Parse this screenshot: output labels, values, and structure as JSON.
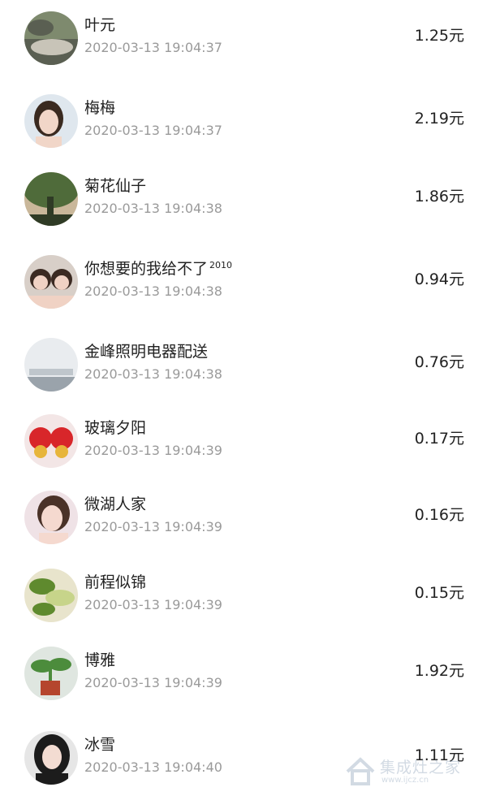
{
  "items": [
    {
      "name": "叶元",
      "name_sup": "",
      "time": "2020-03-13 19:04:37",
      "amount": "1.25元",
      "avatar_icon": "landscape-rock-photo",
      "colors": [
        "#7e8a6e",
        "#c8c4b8",
        "#5a5f52"
      ]
    },
    {
      "name": "梅梅",
      "name_sup": "",
      "time": "2020-03-13 19:04:37",
      "amount": "2.19元",
      "avatar_icon": "girl-portrait-photo",
      "colors": [
        "#dfe7ee",
        "#f1d6c8",
        "#3a2a20"
      ]
    },
    {
      "name": "菊花仙子",
      "name_sup": "",
      "time": "2020-03-13 19:04:38",
      "amount": "1.86元",
      "avatar_icon": "tree-garden-photo",
      "colors": [
        "#4f6b3a",
        "#c9b79a",
        "#2f3b25"
      ]
    },
    {
      "name": "你想要的我给不了",
      "name_sup": "2010",
      "time": "2020-03-13 19:04:38",
      "amount": "0.94元",
      "avatar_icon": "two-children-photo",
      "colors": [
        "#d8cfc8",
        "#f0d2c4",
        "#3b2a22"
      ]
    },
    {
      "name": "金峰照明电器配送",
      "name_sup": "",
      "time": "2020-03-13 19:04:38",
      "amount": "0.76元",
      "avatar_icon": "office-wall-photo",
      "colors": [
        "#e9ecef",
        "#bfc6cc",
        "#9aa3ab"
      ]
    },
    {
      "name": "玻璃夕阳",
      "name_sup": "",
      "time": "2020-03-13 19:04:39",
      "amount": "0.17元",
      "avatar_icon": "red-festival-decor-photo",
      "colors": [
        "#f3e6e6",
        "#d8262a",
        "#e7b53b"
      ]
    },
    {
      "name": "微湖人家",
      "name_sup": "",
      "time": "2020-03-13 19:04:39",
      "amount": "0.16元",
      "avatar_icon": "woman-portrait-photo",
      "colors": [
        "#efe2e6",
        "#f5d9cf",
        "#4a3228"
      ]
    },
    {
      "name": "前程似锦",
      "name_sup": "",
      "time": "2020-03-13 19:04:39",
      "amount": "0.15元",
      "avatar_icon": "green-plant-photo",
      "colors": [
        "#c7d48a",
        "#5f8a2e",
        "#e8e4cc"
      ]
    },
    {
      "name": "博雅",
      "name_sup": "",
      "time": "2020-03-13 19:04:39",
      "amount": "1.92元",
      "avatar_icon": "potted-plant-photo",
      "colors": [
        "#dfe6e0",
        "#4c8c3c",
        "#b5462e"
      ]
    },
    {
      "name": "冰雪",
      "name_sup": "",
      "time": "2020-03-13 19:04:40",
      "amount": "1.11元",
      "avatar_icon": "woman-black-hair-photo",
      "colors": [
        "#e6e6e6",
        "#f3dcd2",
        "#1c1c1c"
      ]
    }
  ],
  "watermark": {
    "text": "集成灶之家",
    "sub": "www.ijcz.cn",
    "icon": "house-logo-icon"
  }
}
